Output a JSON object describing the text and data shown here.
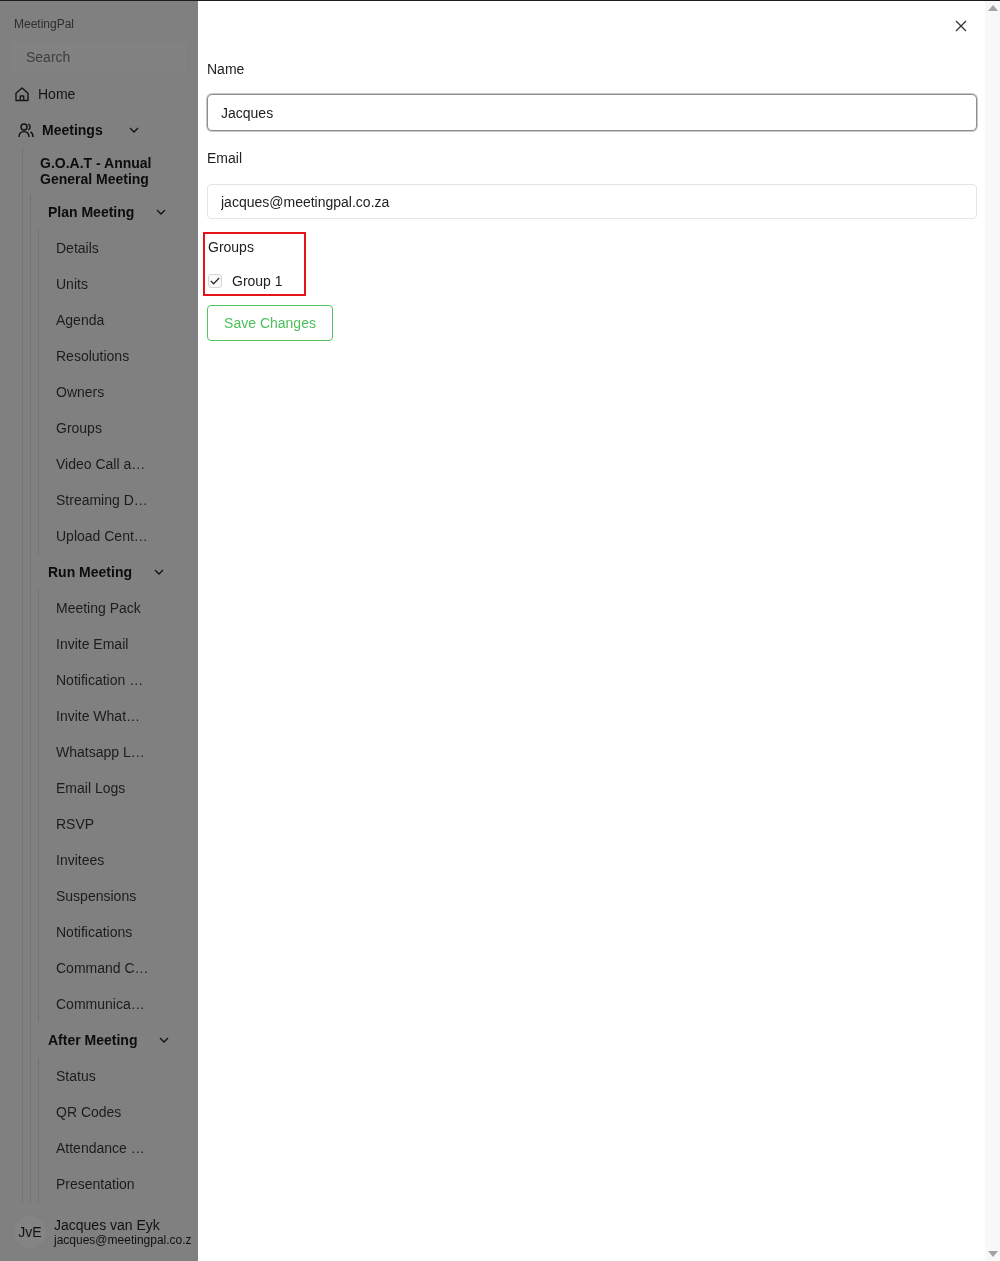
{
  "sidebar": {
    "app_name": "MeetingPal",
    "search": {
      "placeholder": "Search"
    },
    "home": {
      "label": "Home"
    },
    "meetings": {
      "label": "Meetings",
      "expanded": true,
      "children": [
        {
          "label": "G.O.A.T - Annual General Meeting",
          "children": [
            {
              "label": "Plan Meeting",
              "expanded": true,
              "children": [
                {
                  "label": "Details"
                },
                {
                  "label": "Units"
                },
                {
                  "label": "Agenda"
                },
                {
                  "label": "Resolutions"
                },
                {
                  "label": "Owners"
                },
                {
                  "label": "Groups"
                },
                {
                  "label": "Video Call a…"
                },
                {
                  "label": "Streaming D…"
                },
                {
                  "label": "Upload Cent…"
                }
              ]
            },
            {
              "label": "Run Meeting",
              "expanded": true,
              "children": [
                {
                  "label": "Meeting Pack"
                },
                {
                  "label": "Invite Email"
                },
                {
                  "label": "Notification …"
                },
                {
                  "label": "Invite What…"
                },
                {
                  "label": "Whatsapp L…"
                },
                {
                  "label": "Email Logs"
                },
                {
                  "label": "RSVP"
                },
                {
                  "label": "Invitees"
                },
                {
                  "label": "Suspensions"
                },
                {
                  "label": "Notifications"
                },
                {
                  "label": "Command C…"
                },
                {
                  "label": "Communica…"
                }
              ]
            },
            {
              "label": "After Meeting",
              "expanded": true,
              "children": [
                {
                  "label": "Status"
                },
                {
                  "label": "QR Codes"
                },
                {
                  "label": "Attendance …"
                },
                {
                  "label": "Presentation"
                }
              ]
            }
          ]
        }
      ]
    },
    "user": {
      "initials": "JvE",
      "name": "Jacques van Eyk",
      "email": "jacques@meetingpal.co.z"
    }
  },
  "drawer": {
    "fields": [
      {
        "label": "Name",
        "value": "Jacques",
        "focused": true
      },
      {
        "label": "Email",
        "value": "jacques@meetingpal.co.za",
        "focused": false
      }
    ],
    "groups": {
      "label": "Groups",
      "highlighted": true,
      "options": [
        {
          "label": "Group 1",
          "checked": true
        }
      ]
    },
    "save_button": {
      "label": "Save Changes"
    }
  }
}
